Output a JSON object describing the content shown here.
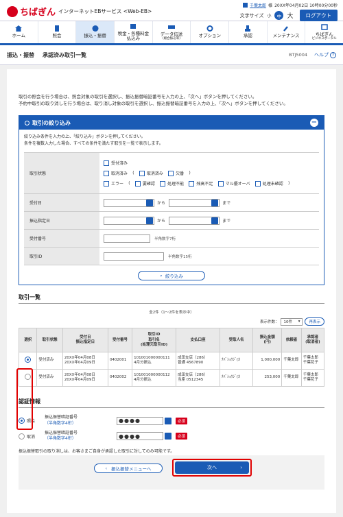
{
  "header": {
    "brand": "ちばぎん",
    "service": "インターネットEBサービス <Web-EB>",
    "user_name": "千葉太郎",
    "user_suffix": "様",
    "last_login": "20XX年04月02日 10時00分00秒",
    "font_size_label": "文字サイズ",
    "font_small": "小",
    "font_mid": "中",
    "font_big": "大",
    "logout": "ログアウト"
  },
  "nav": [
    {
      "label": "ホーム",
      "sub": "",
      "icon": "home-icon"
    },
    {
      "label": "照会",
      "sub": "",
      "icon": "document-icon"
    },
    {
      "label": "振込・振替",
      "sub": "",
      "icon": "transfer-icon",
      "active": true
    },
    {
      "label": "税金・各種料金",
      "label2": "払込み",
      "sub": "",
      "icon": "coin-icon"
    },
    {
      "label": "データ伝送",
      "label2": "(総合振込等)",
      "sub": "",
      "icon": "data-icon"
    },
    {
      "label": "オプション",
      "sub": "",
      "icon": "gear-icon"
    },
    {
      "label": "承認",
      "sub": "",
      "icon": "stamp-icon"
    },
    {
      "label": "メンテナンス",
      "sub": "",
      "icon": "wrench-icon"
    },
    {
      "label": "ちばぎん",
      "label2": "ビジネスポータル",
      "sub": "",
      "icon": "portal-icon"
    }
  ],
  "title": {
    "category": "振込・振替",
    "page": "承認済み取引一覧",
    "code": "BTJ5004",
    "help": "ヘルプ"
  },
  "intro": [
    "取引の照会を行う場合は、照会対象の取引を選択し、振込振替暗証番号を入力の上、「次へ」ボタンを押してください。",
    "予約中取引の取り消しを行う場合は、取り消し対象の取引を選択し、振込振替暗証番号を入力の上、「次へ」ボタンを押してください。"
  ],
  "filter": {
    "title": "取引の絞り込み",
    "note1": "絞り込み条件を入力の上、「絞り込み」ボタンを押してください。",
    "note2": "条件を複数入力した場合、すべての条件を満たす取引を一覧で表示します。",
    "rows": {
      "status": "取引状態",
      "accept_date": "受付日",
      "transfer_date": "振込指定日",
      "accept_no": "受付番号",
      "tx_id": "取引ID"
    },
    "checkboxes": {
      "accepted": "受付済み",
      "cancelled": "取消済み",
      "paren_open": "(",
      "cancelled2": "取消済み",
      "missing": "欠番",
      "paren_close": ")",
      "error": "エラー",
      "paren_open2": "(",
      "unconfirmed": "要確認",
      "unprocessable": "処理不能",
      "insufficient": "残高不足",
      "limit_over": "マル優オーバ",
      "processing_unconfirmed": "処理未確認",
      "paren_close2": ")"
    },
    "from": "から",
    "to": "まで",
    "hint_accept": "半角数字7桁",
    "hint_txid": "半角数字15桁",
    "button": "絞り込み"
  },
  "list": {
    "title": "取引一覧",
    "count": "全2件（1～2件を表示中）",
    "display_count_label": "表示件数：",
    "display_count_value": "10件",
    "redisplay": "再表示",
    "headers": [
      "選択",
      "取引状態",
      "受付日\n振込指定日",
      "受付番号",
      "取引ID\n取引名\n(処理元取引ID)",
      "支払口座",
      "受取人名",
      "振込金額\n(円)",
      "依頼者",
      "承認者\n(取消者)"
    ],
    "rows": [
      {
        "selected": true,
        "status": "受付済み",
        "dates": [
          "20XX年04月08日",
          "20XX年04月09日"
        ],
        "accept_no": "0402001",
        "txid": [
          "101001000000111",
          "4月分振込"
        ],
        "account": [
          "成田支店（286）",
          "普通 4567890"
        ],
        "payee": "ﾁﾊﾞｼｮｳｼﾞ(ｶ",
        "amount": "1,000,000",
        "requester": "千葉太郎",
        "approver": [
          "千葉太郎",
          "千葉花子"
        ]
      },
      {
        "selected": false,
        "status": "受付済み",
        "dates": [
          "20XX年04月08日",
          "20XX年04月09日"
        ],
        "accept_no": "0402002",
        "txid": [
          "101001000000112",
          "4月分振込"
        ],
        "account": [
          "成田支店（286）",
          "当座 0512345"
        ],
        "payee": "ﾁﾊﾞｼｮｳｼﾞ(ｶ",
        "amount": "253,000",
        "requester": "千葉太郎",
        "approver": [
          "千葉太郎",
          "千葉花子"
        ]
      }
    ]
  },
  "auth": {
    "title": "認証情報",
    "inquiry": "照会",
    "cancel": "取消",
    "pw_label": "振込振替暗証番号",
    "pw_sub": "（半角数字4桁）",
    "pw_mask": "●●●●",
    "required": "必須",
    "note": "振込振替取引の取り消しは、お客さまご自身が承認した取引に対してのみ可能です。"
  },
  "footer": {
    "back": "振込振替メニューへ",
    "next": "次へ"
  }
}
